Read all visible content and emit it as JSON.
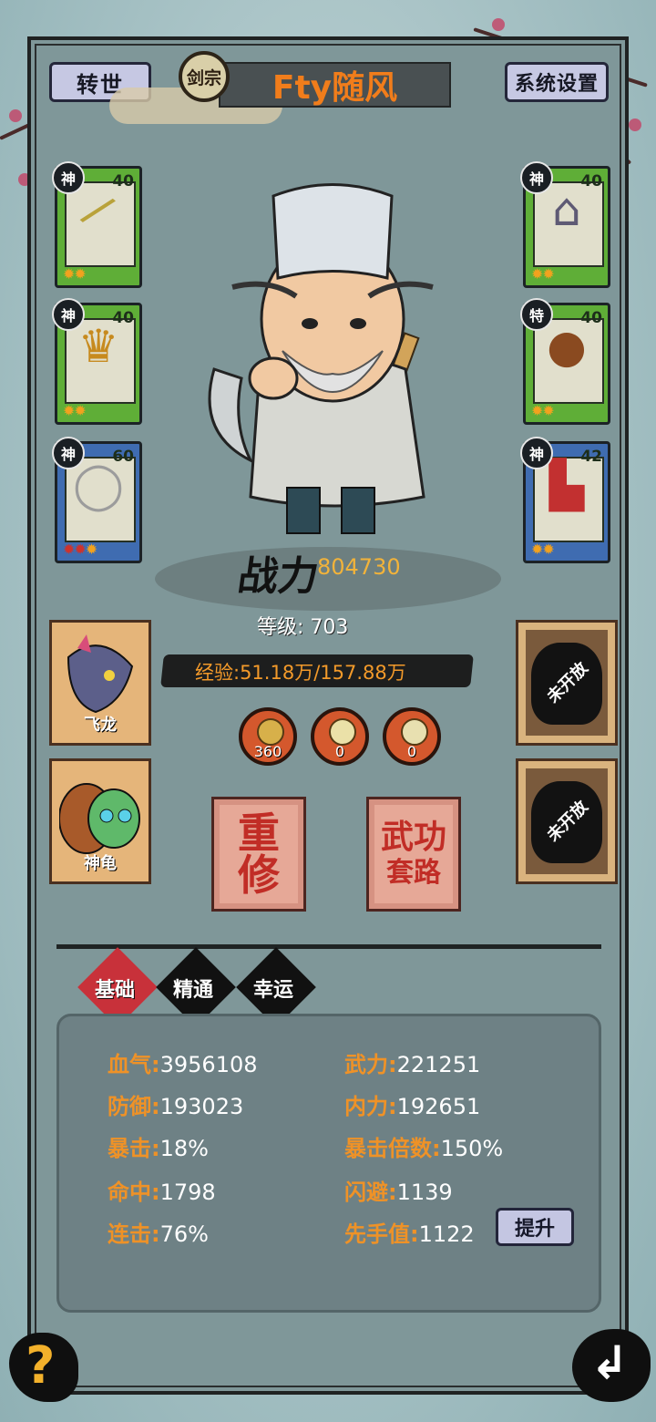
{
  "header": {
    "reincarnate_label": "转世",
    "sect_label": "剑宗",
    "player_name": "Fty随风",
    "settings_label": "系统设置"
  },
  "equipment": {
    "left": [
      {
        "rank": "神",
        "level": "40",
        "stars": [
          "✹",
          "✹"
        ],
        "item_icon": "sword-icon",
        "quality": "green"
      },
      {
        "rank": "神",
        "level": "40",
        "stars": [
          "✹",
          "✹"
        ],
        "item_icon": "armor-icon",
        "quality": "green"
      },
      {
        "rank": "神",
        "level": "60",
        "stars": [
          "✹",
          "✹",
          "✹"
        ],
        "item_icon": "ring-icon",
        "quality": "blue"
      }
    ],
    "right": [
      {
        "rank": "神",
        "level": "40",
        "stars": [
          "✹",
          "✹"
        ],
        "item_icon": "hat-icon",
        "quality": "green"
      },
      {
        "rank": "特",
        "level": "40",
        "stars": [
          "✹",
          "✹"
        ],
        "item_icon": "gourd-icon",
        "quality": "green"
      },
      {
        "rank": "神",
        "level": "42",
        "stars": [
          "✹",
          "✹"
        ],
        "item_icon": "boots-icon",
        "quality": "blue"
      }
    ]
  },
  "character": {
    "power_label": "战力",
    "power_value": "804730",
    "level_text": "等级: 703",
    "exp_text": "经验:51.18万/157.88万"
  },
  "pets": {
    "left": [
      {
        "label": "飞龙",
        "icon": "dragon-icon"
      },
      {
        "label": "神龟",
        "icon": "turtle-icon"
      }
    ],
    "right": [
      {
        "label": "未开放",
        "icon": "lock-icon"
      },
      {
        "label": "未开放",
        "icon": "lock-icon"
      }
    ]
  },
  "items": [
    {
      "count": "360",
      "icon": "gold-pearl-icon"
    },
    {
      "count": "0",
      "icon": "white-pearl-icon"
    },
    {
      "count": "0",
      "icon": "jade-pearl-icon"
    }
  ],
  "actions": {
    "retrain": {
      "line1": "重",
      "line2": "修"
    },
    "martial": {
      "line1": "武功",
      "line2": "套路"
    }
  },
  "tabs": [
    {
      "label": "基础",
      "active": true
    },
    {
      "label": "精通",
      "active": false
    },
    {
      "label": "幸运",
      "active": false
    }
  ],
  "stats": [
    {
      "key": "血气:",
      "value": "3956108"
    },
    {
      "key": "武力:",
      "value": "221251"
    },
    {
      "key": "防御:",
      "value": "193023"
    },
    {
      "key": "内力:",
      "value": "192651"
    },
    {
      "key": "暴击:",
      "value": "18%"
    },
    {
      "key": "暴击倍数:",
      "value": "150%"
    },
    {
      "key": "命中:",
      "value": "1798"
    },
    {
      "key": "闪避:",
      "value": "1139"
    },
    {
      "key": "连击:",
      "value": "76%"
    },
    {
      "key": "先手值:",
      "value": "1122"
    }
  ],
  "upgrade_label": "提升",
  "footer": {
    "help_label": "?",
    "back_label": "↲"
  },
  "colors": {
    "accent_orange": "#f17d1b",
    "stat_key": "#ef9227",
    "power_value": "#f2b33a",
    "tab_active": "#c8313a",
    "tab_inactive": "#111111"
  }
}
